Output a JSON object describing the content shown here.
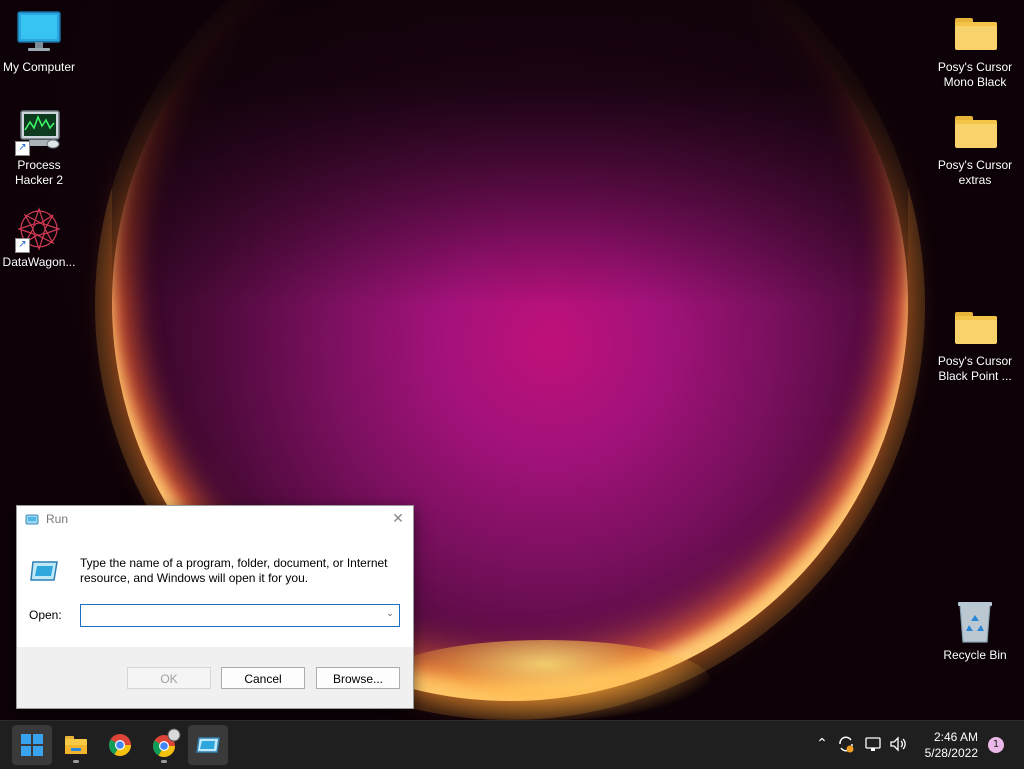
{
  "desktop": {
    "icons_left": [
      {
        "label": "My Computer",
        "icon": "monitor-icon"
      },
      {
        "label": "Process Hacker 2",
        "icon": "process-hacker-icon"
      },
      {
        "label": "DataWagon...",
        "icon": "datawagon-icon"
      }
    ],
    "icons_right": [
      {
        "label": "Posy's Cursor Mono Black",
        "icon": "folder-icon"
      },
      {
        "label": "Posy's Cursor extras",
        "icon": "folder-icon"
      },
      {
        "label": "Posy's Cursor Black Point ...",
        "icon": "folder-icon"
      },
      {
        "label": "Recycle Bin",
        "icon": "recycle-bin-icon"
      }
    ]
  },
  "run_dialog": {
    "title": "Run",
    "description": "Type the name of a program, folder, document, or Internet resource, and Windows will open it for you.",
    "open_label": "Open:",
    "open_value": "",
    "buttons": {
      "ok": "OK",
      "cancel": "Cancel",
      "browse": "Browse..."
    }
  },
  "taskbar": {
    "apps": [
      "start-icon",
      "file-explorer-icon",
      "chrome-icon",
      "chrome-profile-icon",
      "run-icon"
    ],
    "tray": [
      "chevron-up-icon",
      "sync-icon",
      "network-icon",
      "volume-icon"
    ],
    "time": "2:46 AM",
    "date": "5/28/2022",
    "notification_count": "1"
  },
  "colors": {
    "taskbar": "#1f1f1f",
    "accent": "#1b6fc8",
    "folder": "#f8d26a"
  }
}
